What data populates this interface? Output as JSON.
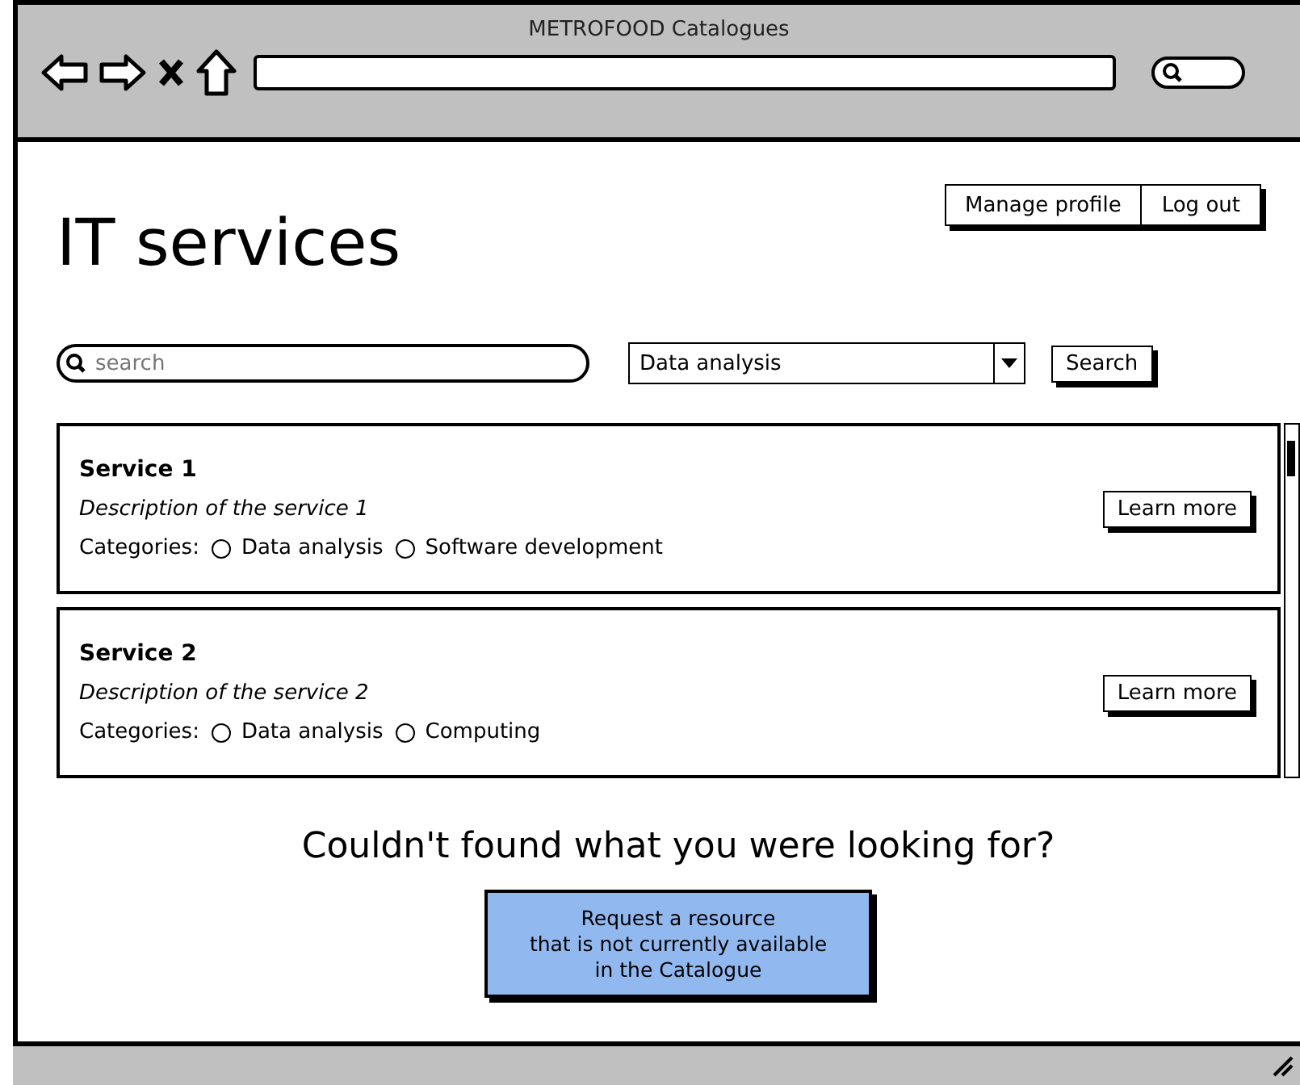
{
  "window": {
    "title": "METROFOOD Catalogues"
  },
  "header": {
    "title": "IT services",
    "actions": [
      "Manage profile",
      "Log out"
    ]
  },
  "search": {
    "placeholder": "search",
    "category": "Data analysis",
    "button": "Search"
  },
  "services": [
    {
      "name": "Service 1",
      "description": "Description of the service 1",
      "categories_label": "Categories:",
      "categories": [
        {
          "label": "Data analysis",
          "checked": false
        },
        {
          "label": "Software development",
          "checked": false
        }
      ],
      "button": "Learn more"
    },
    {
      "name": "Service 2",
      "description": "Description of the service 2",
      "categories_label": "Categories:",
      "categories": [
        {
          "label": "Data analysis",
          "checked": false
        },
        {
          "label": "Computing",
          "checked": false
        }
      ],
      "button": "Learn more"
    }
  ],
  "footer": {
    "question": "Couldn't found what you were looking for?",
    "request_lines": [
      "Request a resource",
      "that is not currently available",
      "in the Catalogue"
    ]
  }
}
